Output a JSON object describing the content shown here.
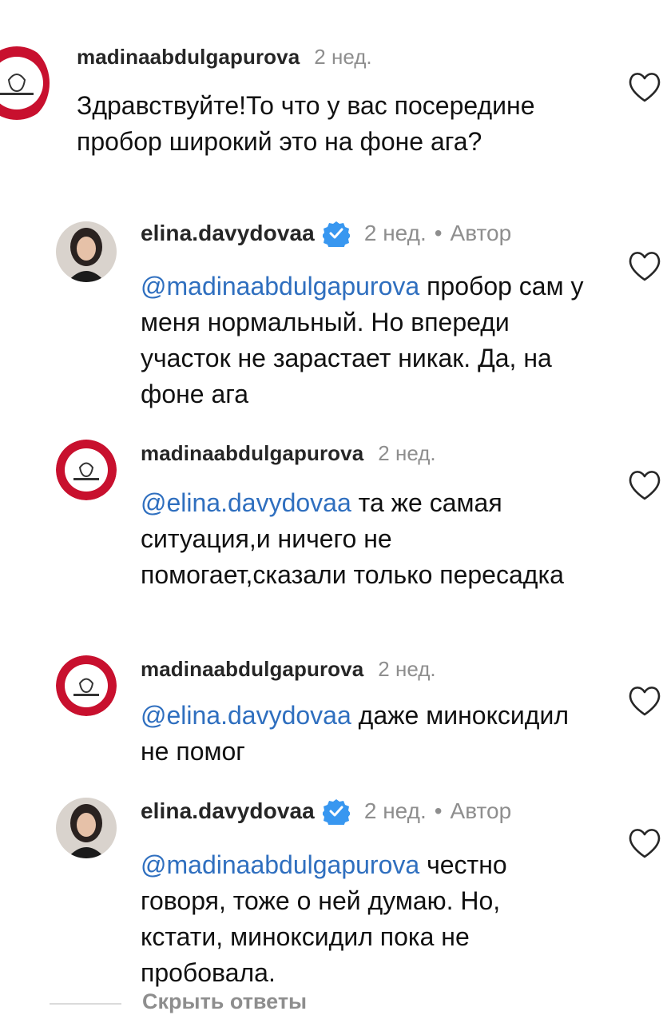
{
  "comments": [
    {
      "username": "madinaabdulgapurova",
      "time": "2 нед.",
      "text": "Здравствуйте!То что у вас посередине пробор широкий это на фоне ага?"
    },
    {
      "username": "elina.davydovaa",
      "time": "2 нед.",
      "author_label": "Автор",
      "dot": "•",
      "mention": "@madinaabdulgapurova",
      "text": " пробор сам у меня нормальный. Но впереди участок не зарастает никак. Да, на фоне ага"
    },
    {
      "username": "madinaabdulgapurova",
      "time": "2 нед.",
      "mention": "@elina.davydovaa",
      "text": " та же самая ситуация,и ничего не помогает,сказали только пересадка"
    },
    {
      "username": "madinaabdulgapurova",
      "time": "2 нед.",
      "mention": "@elina.davydovaa",
      "text": " даже миноксидил не помог"
    },
    {
      "username": "elina.davydovaa",
      "time": "2 нед.",
      "author_label": "Автор",
      "dot": "•",
      "mention": "@madinaabdulgapurova",
      "text": " честно говоря, тоже о ней думаю. Но, кстати, миноксидил пока не пробовала."
    }
  ],
  "hide_replies": "Скрыть ответы",
  "colors": {
    "mention": "#2f6fbf",
    "verified": "#3897f0",
    "muted": "#8e8e8e",
    "logo_red": "#c8102e"
  },
  "icons": {
    "like": "heart-outline-icon",
    "verified": "verified-badge-icon"
  }
}
